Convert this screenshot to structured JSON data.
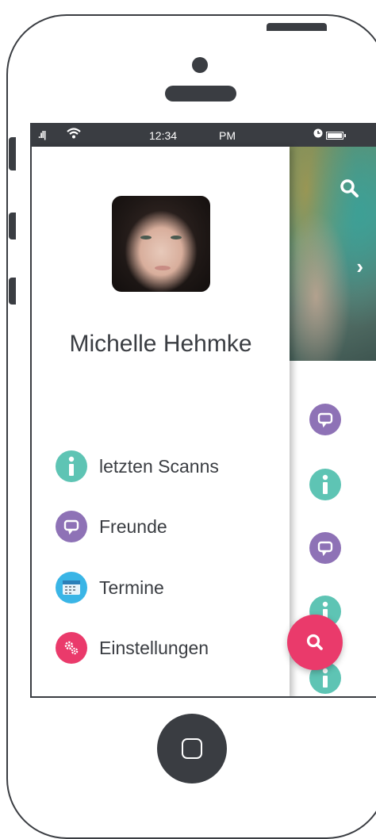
{
  "status_bar": {
    "signal_icon": "signal-bars-icon",
    "wifi_icon": "wifi-icon",
    "time": "12:34",
    "ampm": "PM",
    "alarm_icon": "clock-icon",
    "battery_icon": "battery-icon"
  },
  "profile": {
    "name": "Michelle Hehmke",
    "avatar": "avatar-photo"
  },
  "menu": [
    {
      "label": "letzten Scanns",
      "icon": "info-icon",
      "color": "#5ec4b4"
    },
    {
      "label": "Freunde",
      "icon": "chat-bubble-icon",
      "color": "#8e72b6"
    },
    {
      "label": "Termine",
      "icon": "calendar-icon",
      "color": "#3ab5e6"
    },
    {
      "label": "Einstellungen",
      "icon": "gears-icon",
      "color": "#ea3a6b"
    }
  ],
  "background_icons": [
    {
      "icon": "chat-bubble-icon",
      "color": "#8e72b6"
    },
    {
      "icon": "info-icon",
      "color": "#5ec4b4"
    },
    {
      "icon": "chat-bubble-icon",
      "color": "#8e72b6"
    },
    {
      "icon": "info-icon",
      "color": "#5ec4b4"
    },
    {
      "icon": "info-icon",
      "color": "#5ec4b4"
    }
  ],
  "photo_overlay": {
    "search_icon": "search-icon",
    "next_icon": "chevron-right-icon",
    "next_glyph": "›"
  },
  "fab": {
    "icon": "search-icon",
    "color": "#ea3a6b"
  },
  "home_button": {
    "icon": "home-square-icon"
  }
}
